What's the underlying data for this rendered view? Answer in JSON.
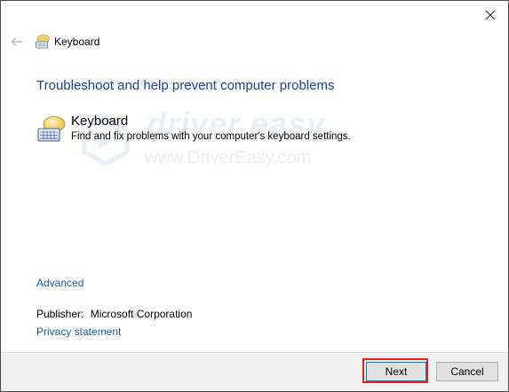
{
  "window": {
    "title": "Keyboard",
    "close_icon": "close-icon",
    "back_icon": "back-arrow-icon"
  },
  "main": {
    "heading": "Troubleshoot and help prevent computer problems",
    "item": {
      "title": "Keyboard",
      "description": "Find and fix problems with your computer's keyboard settings.",
      "icon": "keyboard-troubleshooter-icon"
    },
    "watermark": {
      "name": "driver easy",
      "url": "www.DriverEasy.com"
    },
    "advanced_link": "Advanced",
    "publisher_label": "Publisher:",
    "publisher_value": "Microsoft Corporation",
    "privacy_link": "Privacy statement"
  },
  "footer": {
    "next_label": "Next",
    "cancel_label": "Cancel"
  },
  "colors": {
    "heading": "#1a3fa6",
    "link": "#1a5fb4",
    "highlight": "#e02424",
    "footer_bg": "#f0f0f0"
  }
}
